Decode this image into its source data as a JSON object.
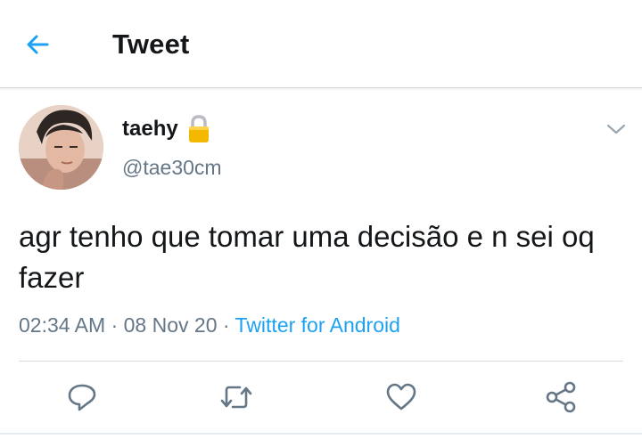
{
  "header": {
    "title": "Tweet"
  },
  "tweet": {
    "display_name": "taehy",
    "handle": "@tae30cm",
    "text": "agr tenho que tomar uma decisão e n sei oq fazer",
    "time": "02:34 AM",
    "separator": "·",
    "date": "08 Nov 20",
    "source": "Twitter for Android"
  },
  "icons": {
    "back": "arrow-left-icon",
    "lock": "lock-icon",
    "more": "chevron-down-icon",
    "reply": "reply-icon",
    "retweet": "retweet-icon",
    "like": "heart-icon",
    "share": "share-icon"
  },
  "colors": {
    "accent": "#1da1f2",
    "text": "#14171a",
    "secondary": "#657786",
    "icon_gray": "#657786"
  }
}
